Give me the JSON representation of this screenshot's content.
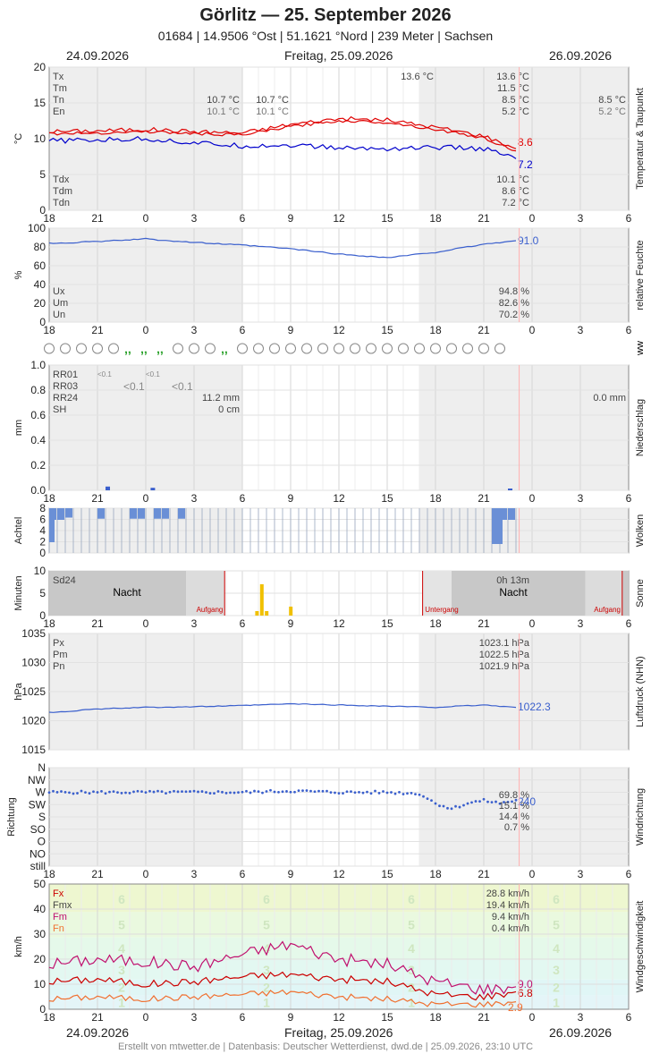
{
  "header": {
    "title": "Görlitz  —  25. September 2026",
    "subtitle": "01684  |  14.9506 °Ost  |  51.1621 °Nord  |  239 Meter  |  Sachsen",
    "date_left": "24.09.2026",
    "date_center": "Freitag, 25.09.2026",
    "date_right": "26.09.2026"
  },
  "footer": {
    "text": "Erstellt von mtwetter.de | Datenbasis: Deutscher Wetterdienst, dwd.de | 25.09.2026, 23:10 UTC"
  },
  "x_ticks": [
    "18",
    "21",
    "0",
    "3",
    "6",
    "9",
    "12",
    "15",
    "18",
    "21",
    "0",
    "3",
    "6"
  ],
  "colors": {
    "grid": "#dddddd",
    "night": "#eeeeee",
    "temp": "#e00000",
    "dew": "#0000cc",
    "humidity": "#3a5fcd",
    "pressure": "#3a5fcd",
    "clouds": "#6a8fd6",
    "sun": "#f0c000",
    "wind_fx": "#cc0000",
    "wind_fm": "#c0106e",
    "wind_fn": "#f07030",
    "beaufort_green": "#e8f5c8",
    "beaufort_cyan": "#dff7f7"
  },
  "panels": {
    "temperature": {
      "ylabel": "°C",
      "side_label": "Temperatur & Taupunkt",
      "y_ticks": [
        "20",
        "15",
        "10",
        "5",
        "0"
      ],
      "stats_left": [
        {
          "k": "Tx",
          "v": "13.6 °C"
        },
        {
          "k": "Tm",
          "v": "11.5 °C"
        },
        {
          "k": "Tn",
          "v": "8.5 °C"
        },
        {
          "k": "En",
          "v": "5.2 °C"
        }
      ],
      "stats_bottom": [
        {
          "k": "Tdx",
          "v": "10.1 °C"
        },
        {
          "k": "Tdm",
          "v": "8.6 °C"
        },
        {
          "k": "Tdn",
          "v": "7.2 °C"
        }
      ],
      "prev_day_tn": "10.7 °C",
      "prev_day_en": "10.1 °C",
      "prev_night_tn": "10.7 °C",
      "prev_night_en": "10.1 °C",
      "next_tn": "8.5 °C",
      "next_en": "5.2 °C",
      "tx_marker": "13.6 °C",
      "last_temp": "8.6",
      "last_dew": "7.2"
    },
    "humidity": {
      "ylabel": "%",
      "side_label": "relative Feuchte",
      "y_ticks": [
        "100",
        "80",
        "60",
        "40",
        "20",
        "0"
      ],
      "stats": [
        {
          "k": "Ux",
          "v": "94.8 %"
        },
        {
          "k": "Um",
          "v": "82.6 %"
        },
        {
          "k": "Un",
          "v": "70.2 %"
        }
      ],
      "last": "91.0"
    },
    "weather": {
      "side_label": "ww"
    },
    "precip": {
      "ylabel": "mm",
      "side_label": "Niederschlag",
      "y_ticks": [
        "1.0",
        "0.8",
        "0.6",
        "0.4",
        "0.2",
        "0.0"
      ],
      "labels": [
        {
          "k": "RR01"
        },
        {
          "k": "RR03"
        },
        {
          "k": "RR24"
        },
        {
          "k": "SH"
        }
      ],
      "rr01_a": "<0.1",
      "rr01_b": "<0.1",
      "rr03_a": "<0.1",
      "rr03_b": "<0.1",
      "rr24": "11.2 mm",
      "sh": "0 cm",
      "rr24_next": "0.0 mm"
    },
    "clouds": {
      "ylabel": "Achtel",
      "side_label": "Wolken",
      "y_ticks": [
        "8",
        "6",
        "4",
        "2",
        "0"
      ]
    },
    "sun": {
      "ylabel": "Minuten",
      "side_label": "Sonne",
      "y_ticks": [
        "10",
        "5",
        "0"
      ],
      "sd24_label": "Sd24",
      "sd24_value": "0h 13m",
      "night": "Nacht",
      "sunrise": "Aufgang",
      "sunset": "Untergang"
    },
    "pressure": {
      "ylabel": "hPa",
      "side_label": "Luftdruck (NHN)",
      "y_ticks": [
        "1035",
        "1030",
        "1025",
        "1020",
        "1015"
      ],
      "stats": [
        {
          "k": "Px",
          "v": "1023.1 hPa"
        },
        {
          "k": "Pm",
          "v": "1022.5 hPa"
        },
        {
          "k": "Pn",
          "v": "1021.9 hPa"
        }
      ],
      "last": "1022.3"
    },
    "wind_dir": {
      "ylabel": "Richtung",
      "side_label": "Windrichtung",
      "y_ticks": [
        "N",
        "NW",
        "W",
        "SW",
        "S",
        "SO",
        "O",
        "NO",
        "still"
      ],
      "stats": [
        "69.8 %",
        "15.1 %",
        "14.4 %",
        "0.7 %"
      ],
      "last": "240"
    },
    "wind_speed": {
      "ylabel": "km/h",
      "side_label": "Windgeschwindigkeit",
      "y_ticks": [
        "50",
        "40",
        "30",
        "20",
        "10",
        "0"
      ],
      "stats": [
        {
          "k": "Fx",
          "v": "28.8 km/h"
        },
        {
          "k": "Fmx",
          "v": "19.4 km/h"
        },
        {
          "k": "Fm",
          "v": "9.4 km/h"
        },
        {
          "k": "Fn",
          "v": "0.4 km/h"
        }
      ],
      "beaufort": [
        "6",
        "5",
        "4",
        "3",
        "2",
        "1"
      ],
      "last_fx": "9.0",
      "last_fm": "6.8",
      "last_fn": "2.9"
    }
  },
  "chart_data": [
    {
      "type": "line",
      "ylabel": "°C",
      "ylim": [
        0,
        20
      ],
      "x_hours_range": [
        -6,
        30
      ],
      "series": [
        {
          "name": "Tx",
          "values_hint": "temperature ~10.5-13.6",
          "x": [
            -6,
            -3,
            0,
            3,
            6,
            9,
            12,
            15,
            18,
            21,
            23
          ],
          "values": [
            11.0,
            11.1,
            11.3,
            11.0,
            10.8,
            12.0,
            12.8,
            12.6,
            11.6,
            10.4,
            8.6
          ]
        },
        {
          "name": "Tdx",
          "x": [
            -6,
            -3,
            0,
            3,
            6,
            9,
            12,
            15,
            18,
            21,
            23
          ],
          "values": [
            9.7,
            9.8,
            10.0,
            9.4,
            9.0,
            9.1,
            8.7,
            8.6,
            8.8,
            8.6,
            7.2
          ]
        }
      ]
    },
    {
      "type": "line",
      "ylabel": "%",
      "ylim": [
        0,
        100
      ],
      "x": [
        -6,
        -3,
        0,
        3,
        6,
        9,
        12,
        15,
        18,
        21,
        23
      ],
      "series": [
        {
          "name": "Ux",
          "values": [
            88,
            90,
            93,
            89,
            86,
            82,
            76,
            72,
            78,
            87,
            91
          ]
        }
      ]
    },
    {
      "type": "bar",
      "ylabel": "mm",
      "ylim": [
        0,
        1
      ],
      "x": [
        -2.5,
        0.3,
        22.5
      ],
      "series": [
        {
          "name": "RR01",
          "values": [
            0.03,
            0.02,
            0.01
          ]
        }
      ]
    },
    {
      "type": "bar",
      "ylabel": "Achtel",
      "ylim": [
        0,
        8
      ],
      "x": [
        -6,
        -5.5,
        -5,
        -3,
        -1,
        -0.5,
        0.5,
        1,
        2,
        21.5,
        22,
        22.5
      ],
      "series": [
        {
          "name": "Wolken",
          "values": [
            8,
            8,
            6,
            7,
            7,
            7,
            7,
            7,
            7,
            8,
            8,
            8
          ]
        }
      ]
    },
    {
      "type": "bar",
      "ylabel": "Minuten",
      "ylim": [
        0,
        10
      ],
      "x": [
        6.8,
        7.1,
        7.4,
        8.9
      ],
      "series": [
        {
          "name": "Sonne",
          "values": [
            1,
            7,
            1,
            2
          ]
        }
      ]
    },
    {
      "type": "line",
      "ylabel": "hPa",
      "ylim": [
        1015,
        1035
      ],
      "x": [
        -6,
        -3,
        0,
        3,
        6,
        9,
        12,
        15,
        18,
        21,
        23
      ],
      "series": [
        {
          "name": "Pm",
          "values": [
            1021.4,
            1022.0,
            1022.3,
            1022.4,
            1022.6,
            1022.9,
            1022.7,
            1022.5,
            1022.3,
            1022.7,
            1022.3
          ]
        }
      ]
    },
    {
      "type": "scatter",
      "ylabel": "Richtung",
      "x": [
        -6,
        -3,
        0,
        3,
        6,
        9,
        12,
        15,
        17,
        18,
        19,
        20,
        21,
        22,
        23
      ],
      "series": [
        {
          "name": "Windrichtung",
          "values": [
            270,
            270,
            270,
            270,
            270,
            275,
            270,
            270,
            265,
            230,
            210,
            230,
            240,
            230,
            240
          ]
        }
      ]
    },
    {
      "type": "line",
      "ylabel": "km/h",
      "ylim": [
        0,
        50
      ],
      "x": [
        -6,
        -3,
        0,
        3,
        6,
        9,
        12,
        15,
        18,
        21,
        23
      ],
      "series": [
        {
          "name": "Fx",
          "values": [
            18,
            20,
            19,
            17,
            22,
            26,
            20,
            18,
            11,
            8,
            9
          ]
        },
        {
          "name": "Fm",
          "values": [
            11,
            12,
            10,
            11,
            13,
            14,
            12,
            11,
            6,
            5,
            7
          ]
        },
        {
          "name": "Fn",
          "values": [
            4,
            5,
            4,
            5,
            6,
            7,
            5,
            4,
            2,
            2,
            3
          ]
        }
      ]
    }
  ]
}
